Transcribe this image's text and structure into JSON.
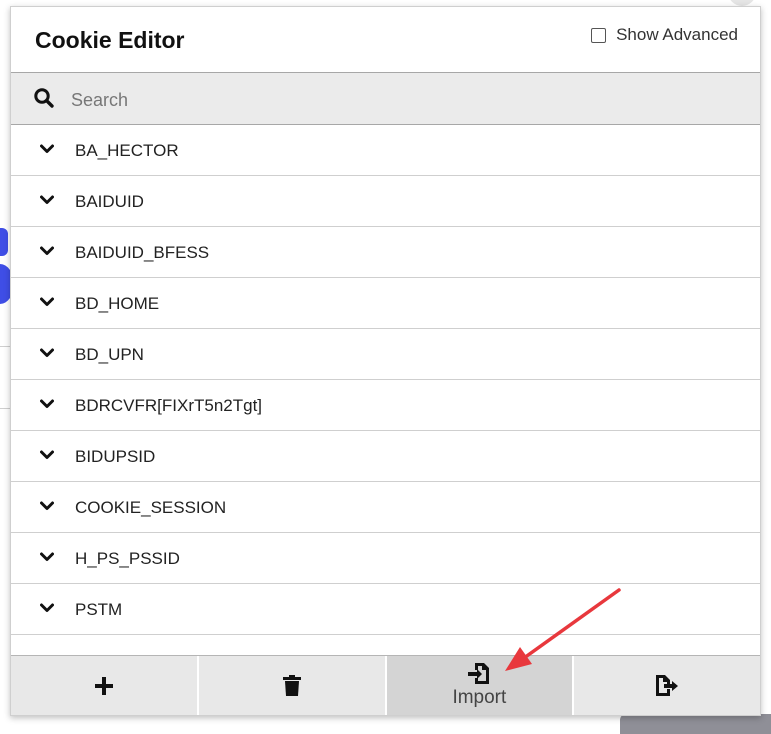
{
  "app": {
    "title": "Cookie Editor",
    "show_advanced_label": "Show Advanced",
    "show_advanced_checked": false
  },
  "search": {
    "placeholder": "Search",
    "value": "",
    "icon": "search-icon"
  },
  "cookies": [
    {
      "name": "BA_HECTOR"
    },
    {
      "name": "BAIDUID"
    },
    {
      "name": "BAIDUID_BFESS"
    },
    {
      "name": "BD_HOME"
    },
    {
      "name": "BD_UPN"
    },
    {
      "name": "BDRCVFR[FIXrT5n2Tgt]"
    },
    {
      "name": "BIDUPSID"
    },
    {
      "name": "COOKIE_SESSION"
    },
    {
      "name": "H_PS_PSSID"
    },
    {
      "name": "PSTM"
    }
  ],
  "footer": {
    "buttons": [
      {
        "icon": "plus-icon",
        "label": ""
      },
      {
        "icon": "trash-icon",
        "label": ""
      },
      {
        "icon": "import-icon",
        "label": "Import"
      },
      {
        "icon": "export-icon",
        "label": ""
      }
    ]
  },
  "colors": {
    "annotation_arrow": "#e8383d",
    "background_accent": "#3f4ee6"
  }
}
